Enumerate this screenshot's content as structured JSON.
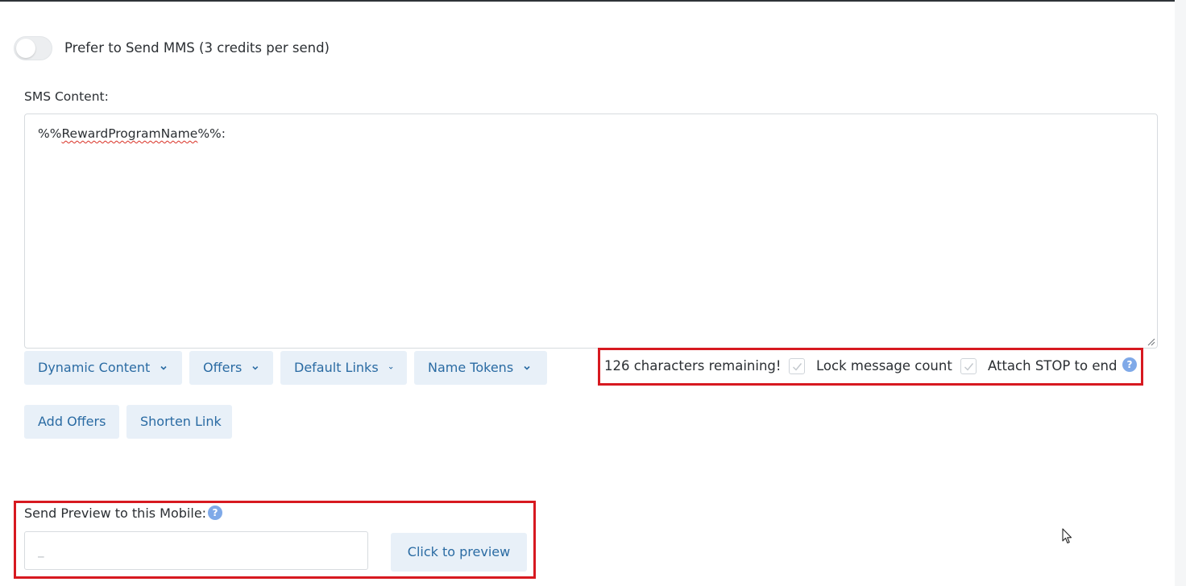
{
  "mms_toggle": {
    "label": "Prefer to Send MMS (3 credits per send)",
    "enabled": false
  },
  "sms_content": {
    "label": "SMS Content:",
    "value_prefix": "%%",
    "value_token": "RewardProgramName",
    "value_suffix": "%%:"
  },
  "toolbar": {
    "dynamic_content": "Dynamic Content",
    "offers": "Offers",
    "default_links": "Default Links",
    "name_tokens": "Name Tokens",
    "add_offers": "Add Offers",
    "shorten_link": "Shorten Link"
  },
  "counter": {
    "remaining_text": "126 characters remaining!",
    "lock_message_count_label": "Lock message count",
    "lock_message_count_checked": true,
    "attach_stop_label": "Attach STOP to end",
    "attach_stop_checked": true,
    "help_icon": "?"
  },
  "preview": {
    "label": "Send Preview to this Mobile:",
    "help_icon": "?",
    "input_placeholder": "_",
    "input_value": "",
    "button_label": "Click to preview"
  },
  "colors": {
    "accent": "#2a6ba3",
    "button_bg": "#e8f0f8",
    "highlight_border": "#d71920",
    "help_icon": "#7fa9e8"
  },
  "icons": {
    "dropdown": "chevron-down-icon",
    "checkbox_mark": "check-icon",
    "help": "question-circle-icon",
    "cursor": "mouse-pointer-icon"
  }
}
